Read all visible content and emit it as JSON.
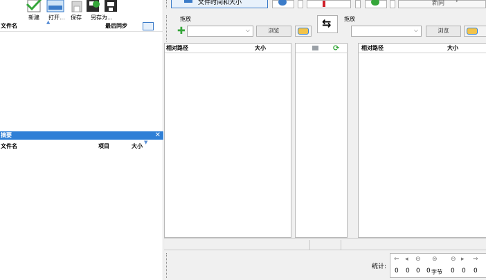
{
  "left_toolbar": {
    "new_label": "新建",
    "open_label": "打开...",
    "save_label": "保存",
    "saveas_label": "另存为..."
  },
  "file_list": {
    "col_name": "文件名",
    "col_last_sync": "最后同步"
  },
  "summary": {
    "title": "摘要",
    "col_name": "文件名",
    "col_item": "项目",
    "col_size": "大小"
  },
  "top_toolbar": {
    "compare_label": "文件时间和大小",
    "sync_label": "新同"
  },
  "left_side": {
    "drag_label": "拖放",
    "browse_label": "浏览",
    "col_path": "相对路径",
    "col_size": "大小"
  },
  "right_side": {
    "drag_label": "拖放",
    "browse_label": "浏览",
    "col_path": "相对路径",
    "col_size": "大小"
  },
  "stats": {
    "label": "统计:",
    "values": [
      "0",
      "0",
      "0",
      "0",
      "0",
      "0",
      "0"
    ],
    "bytes_unit": "字节"
  },
  "colors": {
    "accent": "#2f7fd6",
    "green": "#35a63a"
  }
}
